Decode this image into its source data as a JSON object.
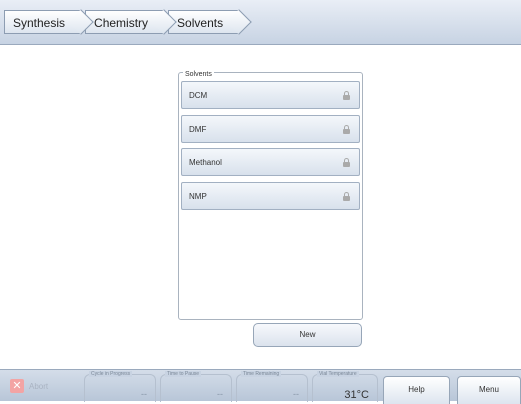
{
  "breadcrumb": [
    "Synthesis",
    "Chemistry",
    "Solvents"
  ],
  "panel": {
    "title": "Solvents",
    "items": [
      {
        "label": "DCM",
        "icon": "lock-icon"
      },
      {
        "label": "DMF",
        "icon": "lock-icon"
      },
      {
        "label": "Methanol",
        "icon": "lock-icon"
      },
      {
        "label": "NMP",
        "icon": "lock-icon"
      }
    ],
    "new_label": "New"
  },
  "footer": {
    "abort_label": "Abort",
    "cycle": {
      "label": "Cycle in Progress",
      "value": "--"
    },
    "pause": {
      "label": "Time to Pause",
      "value": "--"
    },
    "remaining": {
      "label": "Time Remaining",
      "value": "--"
    },
    "temp": {
      "label": "Vial Temperature",
      "value": "31°C"
    },
    "help_label": "Help",
    "menu_label": "Menu"
  }
}
